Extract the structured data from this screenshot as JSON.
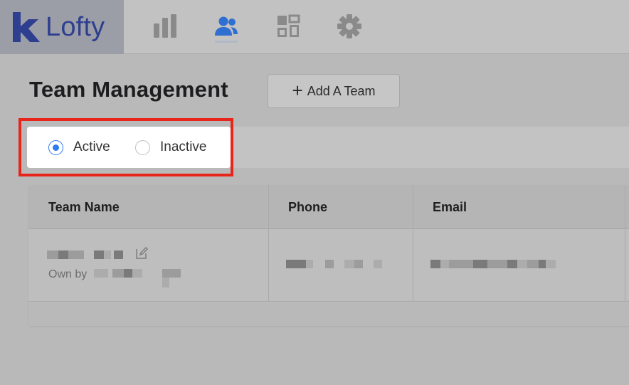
{
  "app": {
    "name": "Lofty"
  },
  "nav": {
    "items": [
      {
        "name": "reports",
        "icon": "bar-chart-icon",
        "active": false
      },
      {
        "name": "team",
        "icon": "users-icon",
        "active": true
      },
      {
        "name": "apps",
        "icon": "grid-icon",
        "active": false
      },
      {
        "name": "settings",
        "icon": "gear-icon",
        "active": false
      }
    ]
  },
  "page": {
    "title": "Team Management",
    "add_button_label": "Add A Team",
    "add_button_icon": "plus-icon"
  },
  "filter": {
    "options": [
      {
        "label": "Active",
        "checked": true
      },
      {
        "label": "Inactive",
        "checked": false
      }
    ]
  },
  "table": {
    "columns": [
      "Team Name",
      "Phone",
      "Email"
    ],
    "rows": [
      {
        "team_name": "[redacted]",
        "owner_prefix": "Own by",
        "owner": "[redacted]",
        "phone": "[redacted]",
        "email": "[redacted]"
      }
    ]
  },
  "colors": {
    "brand": "#2f3f8f",
    "accent": "#2f7bf0",
    "highlight": "#e8251b"
  }
}
